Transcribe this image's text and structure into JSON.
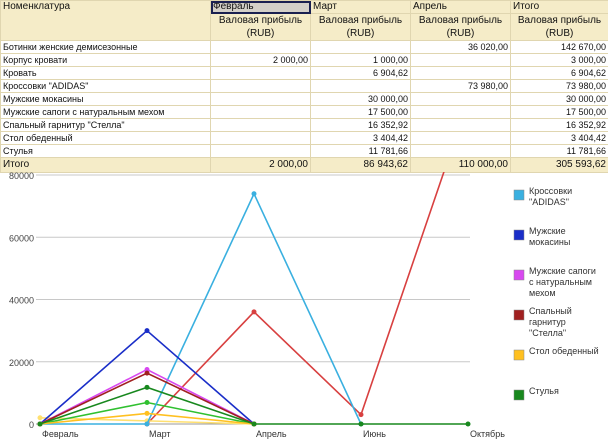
{
  "table": {
    "headers": [
      "Номенклатура",
      "Февраль",
      "Март",
      "Апрель",
      "Итого"
    ],
    "subheader": "Валовая прибыль (RUB)",
    "rows": [
      [
        "Ботинки женские демисезонные",
        "",
        "",
        "36 020,00",
        "142 670,00"
      ],
      [
        "Корпус кровати",
        "2 000,00",
        "1 000,00",
        "",
        "3 000,00"
      ],
      [
        "Кровать",
        "",
        "6 904,62",
        "",
        "6 904,62"
      ],
      [
        "Кроссовки \"ADIDAS\"",
        "",
        "",
        "73 980,00",
        "73 980,00"
      ],
      [
        "Мужские мокасины",
        "",
        "30 000,00",
        "",
        "30 000,00"
      ],
      [
        "Мужские сапоги с натуральным мехом",
        "",
        "17 500,00",
        "",
        "17 500,00"
      ],
      [
        "Спальный гарнитур \"Стелла\"",
        "",
        "16 352,92",
        "",
        "16 352,92"
      ],
      [
        "Стол обеденный",
        "",
        "3 404,42",
        "",
        "3 404,42"
      ],
      [
        "Стулья",
        "",
        "11 781,66",
        "",
        "11 781,66"
      ]
    ],
    "total": [
      "Итого",
      "2 000,00",
      "86 943,62",
      "110 000,00",
      "305 593,62"
    ]
  },
  "chart_data": {
    "type": "line",
    "categories": [
      "Февраль",
      "Март",
      "Апрель",
      "Июнь",
      "Октябрь"
    ],
    "ylim": [
      0,
      80000
    ],
    "yticks": [
      "0",
      "20000",
      "40000",
      "60000",
      "80000"
    ],
    "series": [
      {
        "name": "Ботинки женские демисезонные",
        "color": "#d84040",
        "values": [
          null,
          0,
          36020,
          3000,
          103650
        ],
        "legend": false
      },
      {
        "name": "Корпус кровати",
        "color": "#ffe070",
        "values": [
          2000,
          1000,
          0
        ],
        "legend": false
      },
      {
        "name": "Кровать",
        "color": "#30c030",
        "values": [
          0,
          6904.62,
          0
        ],
        "legend": false
      },
      {
        "name": "Кроссовки \"ADIDAS\"",
        "color": "#3ab0e0",
        "values": [
          0,
          0,
          73980,
          0
        ],
        "legend": true
      },
      {
        "name": "Мужские мокасины",
        "color": "#1a2ec8",
        "values": [
          0,
          30000,
          0
        ],
        "legend": true
      },
      {
        "name": "Мужские сапоги с натуральным мехом",
        "color": "#d848f0",
        "values": [
          0,
          17500,
          0
        ],
        "legend": true
      },
      {
        "name": "Спальный гарнитур \"Стелла\"",
        "color": "#a02020",
        "values": [
          0,
          16352.92,
          0
        ],
        "legend": true
      },
      {
        "name": "Стол обеденный",
        "color": "#ffc020",
        "values": [
          0,
          3404.42,
          0
        ],
        "legend": true
      },
      {
        "name": "Стулья",
        "color": "#18881e",
        "values": [
          0,
          11781.66,
          0,
          0,
          0
        ],
        "legend": true
      }
    ]
  }
}
